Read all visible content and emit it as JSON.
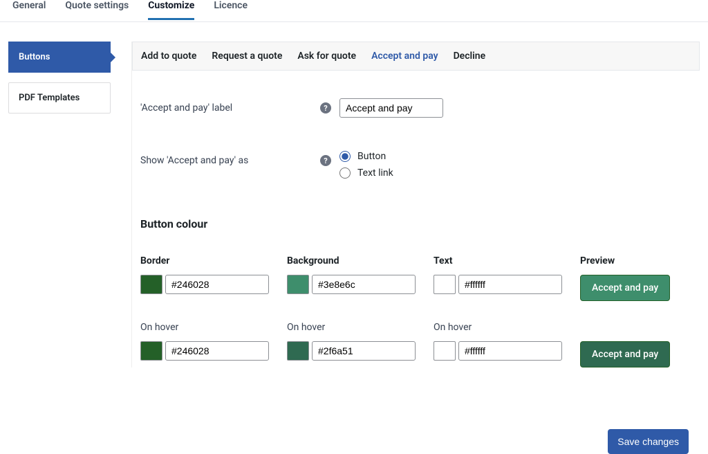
{
  "top_tabs": {
    "general": "General",
    "quote_settings": "Quote settings",
    "customize": "Customize",
    "licence": "Licence",
    "active": "customize"
  },
  "sidebar": {
    "items": [
      {
        "key": "buttons",
        "label": "Buttons",
        "active": true
      },
      {
        "key": "pdf-templates",
        "label": "PDF Templates",
        "active": false
      }
    ]
  },
  "sub_tabs": {
    "items": [
      {
        "key": "add-to-quote",
        "label": "Add to quote"
      },
      {
        "key": "request-quote",
        "label": "Request a quote"
      },
      {
        "key": "ask-for-quote",
        "label": "Ask for quote"
      },
      {
        "key": "accept-and-pay",
        "label": "Accept and pay"
      },
      {
        "key": "decline",
        "label": "Decline"
      }
    ],
    "active": "accept-and-pay"
  },
  "form": {
    "label_field_label": "'Accept and pay' label",
    "label_field_value": "Accept and pay",
    "show_as_label": "Show 'Accept and pay' as",
    "show_as_options": {
      "button": "Button",
      "text_link": "Text link"
    },
    "show_as_selected": "button"
  },
  "section_title": "Button colour",
  "colors": {
    "headers": {
      "border": "Border",
      "background": "Background",
      "text": "Text",
      "preview": "Preview"
    },
    "hover_label": "On hover",
    "normal": {
      "border": "#246028",
      "background": "#3e8e6c",
      "text": "#ffffff"
    },
    "hover": {
      "border": "#246028",
      "background": "#2f6a51",
      "text": "#ffffff"
    }
  },
  "preview_label": "Accept and pay",
  "save_label": "Save changes"
}
